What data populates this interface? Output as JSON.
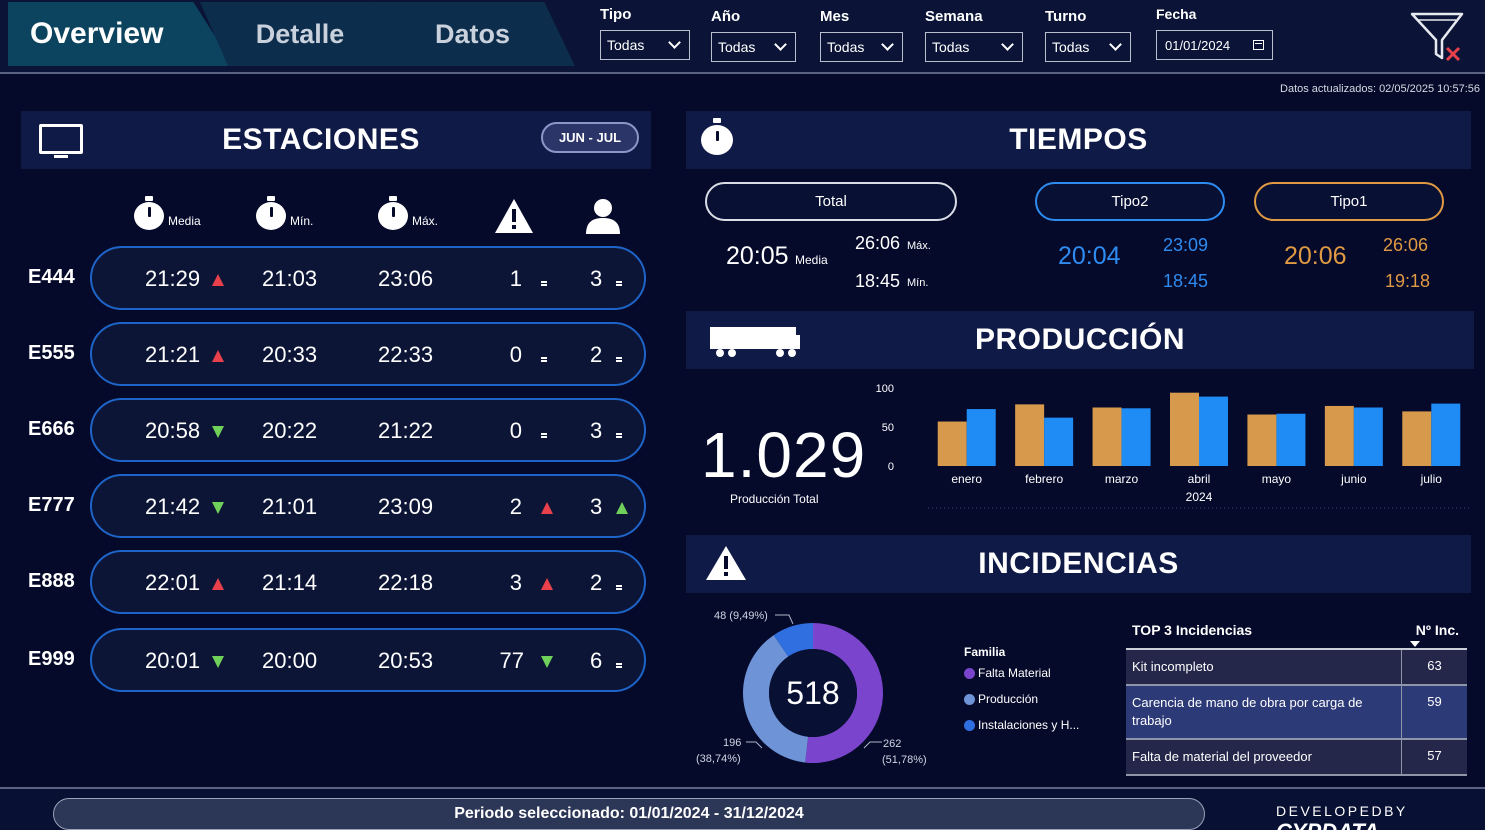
{
  "tabs": [
    {
      "label": "Overview",
      "active": true
    },
    {
      "label": "Detalle",
      "active": false
    },
    {
      "label": "Datos",
      "active": false
    }
  ],
  "filters": [
    {
      "label": "Tipo",
      "value": "Todas"
    },
    {
      "label": "Año",
      "value": "Todas"
    },
    {
      "label": "Mes",
      "value": "Todas"
    },
    {
      "label": "Semana",
      "value": "Todas"
    },
    {
      "label": "Turno",
      "value": "Todas"
    },
    {
      "label": "Fecha",
      "value": "01/01/2024"
    }
  ],
  "updated": "Datos actualizados: 02/05/2025 10:57:56",
  "estaciones": {
    "title": "ESTACIONES",
    "range": "JUN - JUL",
    "col_labels": {
      "media": "Media",
      "min": "Mín.",
      "max": "Máx."
    },
    "rows": [
      {
        "name": "E444",
        "media": "21:29",
        "media_trend": "up-red",
        "min": "21:03",
        "max": "23:06",
        "alerts": "1",
        "alerts_trend": "equal",
        "people": "3",
        "people_trend": "equal"
      },
      {
        "name": "E555",
        "media": "21:21",
        "media_trend": "up-red",
        "min": "20:33",
        "max": "22:33",
        "alerts": "0",
        "alerts_trend": "equal",
        "people": "2",
        "people_trend": "equal"
      },
      {
        "name": "E666",
        "media": "20:58",
        "media_trend": "down-green",
        "min": "20:22",
        "max": "21:22",
        "alerts": "0",
        "alerts_trend": "equal",
        "people": "3",
        "people_trend": "equal"
      },
      {
        "name": "E777",
        "media": "21:42",
        "media_trend": "down-green",
        "min": "21:01",
        "max": "23:09",
        "alerts": "2",
        "alerts_trend": "up-red",
        "people": "3",
        "people_trend": "up-green"
      },
      {
        "name": "E888",
        "media": "22:01",
        "media_trend": "up-red",
        "min": "21:14",
        "max": "22:18",
        "alerts": "3",
        "alerts_trend": "up-red",
        "people": "2",
        "people_trend": "equal"
      },
      {
        "name": "E999",
        "media": "20:01",
        "media_trend": "down-green",
        "min": "20:00",
        "max": "20:53",
        "alerts": "77",
        "alerts_trend": "down-green",
        "people": "6",
        "people_trend": "equal"
      }
    ]
  },
  "tiempos": {
    "title": "TIEMPOS",
    "total": {
      "label": "Total",
      "media": "20:05",
      "media_label": "Media",
      "max": "26:06",
      "max_label": "Máx.",
      "min": "18:45",
      "min_label": "Mín."
    },
    "tipo2": {
      "label": "Tipo2",
      "media": "20:04",
      "max": "23:09",
      "min": "18:45",
      "color": "#2e8bf0"
    },
    "tipo1": {
      "label": "Tipo1",
      "media": "20:06",
      "max": "26:06",
      "min": "19:18",
      "color": "#e09a43"
    }
  },
  "produccion": {
    "title": "PRODUCCIÓN",
    "total": "1.029",
    "total_label": "Producción Total"
  },
  "chart_data": {
    "type": "bar",
    "categories": [
      "enero",
      "febrero",
      "marzo",
      "abril",
      "mayo",
      "junio",
      "julio"
    ],
    "year_label": "2024",
    "series": [
      {
        "values": [
          57,
          79,
          75,
          94,
          66,
          77,
          70
        ],
        "color": "#d79a4c"
      },
      {
        "values": [
          73,
          62,
          74,
          89,
          67,
          75,
          80
        ],
        "color": "#1f8bf5"
      }
    ],
    "y_ticks": [
      "0",
      "50",
      "100"
    ],
    "ylim": [
      0,
      100
    ]
  },
  "incidencias": {
    "title": "INCIDENCIAS",
    "total": "518",
    "slices": [
      {
        "value": 262,
        "label": "262",
        "pct": "(51,78%)",
        "color": "#7a45cc"
      },
      {
        "value": 196,
        "label": "196",
        "pct": "(38,74%)",
        "color": "#6e93d6"
      },
      {
        "value": 48,
        "label": "48 (9,49%)",
        "color": "#2f6fe0"
      }
    ],
    "legend_title": "Familia",
    "legend": [
      {
        "label": "Falta Material",
        "color": "#7a45cc"
      },
      {
        "label": "Producción",
        "color": "#6e93d6"
      },
      {
        "label": "Instalaciones y H...",
        "color": "#2f6fe0"
      }
    ],
    "table": {
      "col1": "TOP 3 Incidencias",
      "col2": "Nº Inc.",
      "rows": [
        {
          "name": "Kit incompleto",
          "count": "63"
        },
        {
          "name": "Carencia de mano de obra por carga de trabajo",
          "count": "59"
        },
        {
          "name": "Falta de material del proveedor",
          "count": "57"
        }
      ]
    }
  },
  "footer": {
    "period": "Periodo seleccionado: 01/01/2024 - 31/12/2024",
    "developed_by": "DEVELOPEDBY",
    "brand": "CYPDATA"
  }
}
